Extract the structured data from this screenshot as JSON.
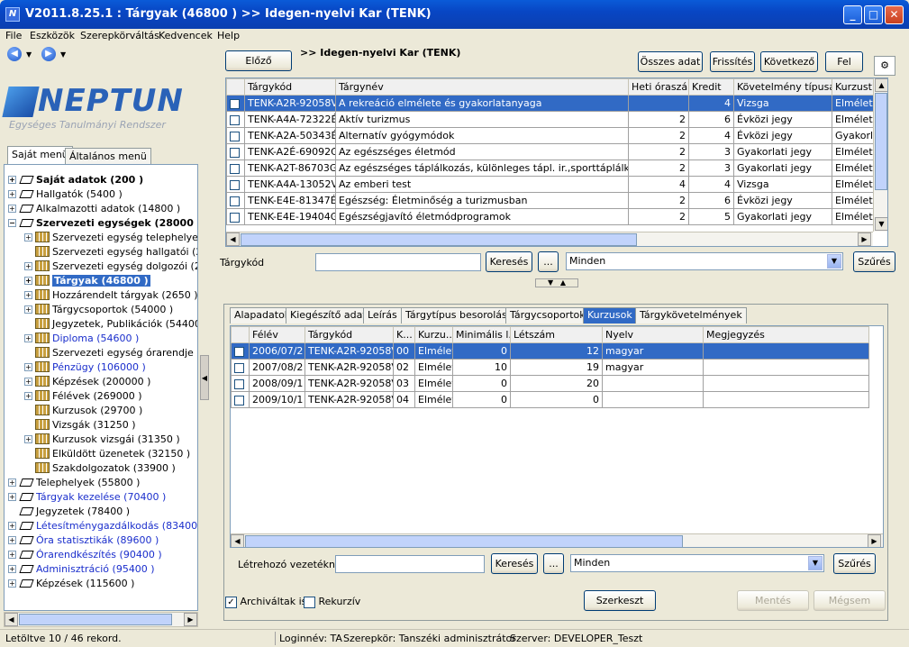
{
  "window": {
    "title": "V2011.8.25.1 : Tárgyak (46800  )  >> Idegen-nyelvi Kar (TENK)",
    "app_icon": "N"
  },
  "menu": [
    "File",
    "Eszközök",
    "Szerepkörváltás",
    "Kedvencek",
    "Help"
  ],
  "logo": {
    "name": "NEPTUN",
    "subtitle": "Egységes Tanulmányi Rendszer"
  },
  "left_tabs": [
    "Saját menü",
    "Általános menü"
  ],
  "tree": [
    {
      "label": "Saját adatok (200  )",
      "level": 0,
      "exp": "+",
      "icon": "tag-icon",
      "bold": true
    },
    {
      "label": "Hallgatók (5400  )",
      "level": 0,
      "exp": "+",
      "icon": "tag-icon"
    },
    {
      "label": "Alkalmazotti adatok (14800  )",
      "level": 0,
      "exp": "+",
      "icon": "tag-icon"
    },
    {
      "label": "Szervezeti egységek (28000  )",
      "level": 0,
      "exp": "−",
      "icon": "tag-icon",
      "bold": true
    },
    {
      "label": "Szervezeti egység telephelyei (28",
      "level": 1,
      "exp": "+",
      "icon": "grid-icon"
    },
    {
      "label": "Szervezeti egység hallgatói (2860",
      "level": 1,
      "exp": "",
      "icon": "grid-icon"
    },
    {
      "label": "Szervezeti egység dolgozói (2880",
      "level": 1,
      "exp": "+",
      "icon": "grid-icon"
    },
    {
      "label": "Tárgyak (46800  )",
      "level": 1,
      "exp": "+",
      "icon": "grid-icon",
      "selected": true,
      "bold": true
    },
    {
      "label": "Hozzárendelt tárgyak (2650  )",
      "level": 1,
      "exp": "+",
      "icon": "grid-icon"
    },
    {
      "label": "Tárgycsoportok (54000  )",
      "level": 1,
      "exp": "+",
      "icon": "grid-icon"
    },
    {
      "label": "Jegyzetek, Publikációk (54400  )",
      "level": 1,
      "exp": "",
      "icon": "grid-icon"
    },
    {
      "label": "Diploma (54600  )",
      "level": 1,
      "exp": "+",
      "icon": "grid-icon",
      "blue": true
    },
    {
      "label": "Szervezeti egység órarendje (559",
      "level": 1,
      "exp": "",
      "icon": "grid-icon"
    },
    {
      "label": "Pénzügy (106000  )",
      "level": 1,
      "exp": "+",
      "icon": "grid-icon",
      "blue": true
    },
    {
      "label": "Képzések (200000  )",
      "level": 1,
      "exp": "+",
      "icon": "grid-icon"
    },
    {
      "label": "Félévek (269000  )",
      "level": 1,
      "exp": "+",
      "icon": "grid-icon"
    },
    {
      "label": "Kurzusok (29700  )",
      "level": 1,
      "exp": "",
      "icon": "grid-icon"
    },
    {
      "label": "Vizsgák (31250  )",
      "level": 1,
      "exp": "",
      "icon": "grid-icon"
    },
    {
      "label": "Kurzusok vizsgái (31350  )",
      "level": 1,
      "exp": "+",
      "icon": "grid-icon"
    },
    {
      "label": "Elküldött üzenetek (32150  )",
      "level": 1,
      "exp": "",
      "icon": "grid-icon"
    },
    {
      "label": "Szakdolgozatok (33900  )",
      "level": 1,
      "exp": "",
      "icon": "grid-icon"
    },
    {
      "label": "Telephelyek (55800  )",
      "level": 0,
      "exp": "+",
      "icon": "tag-icon"
    },
    {
      "label": "Tárgyak kezelése (70400  )",
      "level": 0,
      "exp": "+",
      "icon": "tag-icon",
      "blue": true
    },
    {
      "label": "Jegyzetek (78400  )",
      "level": 0,
      "exp": "",
      "icon": "tag-icon"
    },
    {
      "label": "Létesítménygazdálkodás (83400  )",
      "level": 0,
      "exp": "+",
      "icon": "tag-icon",
      "blue": true
    },
    {
      "label": "Óra statisztikák (89600  )",
      "level": 0,
      "exp": "+",
      "icon": "tag-icon",
      "blue": true
    },
    {
      "label": "Órarendkészítés (90400  )",
      "level": 0,
      "exp": "+",
      "icon": "tag-icon",
      "blue": true
    },
    {
      "label": "Adminisztráció (95400  )",
      "level": 0,
      "exp": "+",
      "icon": "tag-icon",
      "blue": true
    },
    {
      "label": "Képzések (115600  )",
      "level": 0,
      "exp": "+",
      "icon": "tag-icon"
    }
  ],
  "top": {
    "prev_label": "Előző",
    "title": ">> Idegen-nyelvi Kar (TENK)",
    "all_data_label": "Összes adat",
    "refresh_label": "Frissítés",
    "next_label": "Következő",
    "up_label": "Fel",
    "columns": [
      "Tárgykód",
      "Tárgynév",
      "Heti óraszá...",
      "Kredit",
      "Követelmény típusa",
      "Kurzustíp"
    ],
    "rows": [
      [
        "TENK-A2R-92058V",
        "A rekreáció elmélete és gyakorlatanyaga",
        "",
        "4",
        "Vizsga",
        "Elmélet"
      ],
      [
        "TENK-A4A-72322É",
        "Aktív turizmus",
        "2",
        "6",
        "Évközi jegy",
        "Elmélet"
      ],
      [
        "TENK-A2A-50343É",
        "Alternatív gyógymódok",
        "2",
        "4",
        "Évközi jegy",
        "Gyakorlat"
      ],
      [
        "TENK-A2É-69092G",
        "Az egészséges életmód",
        "2",
        "3",
        "Gyakorlati jegy",
        "Elmélet"
      ],
      [
        "TENK-A2T-86703G",
        "Az egészséges táplálkozás, különleges tápl. ir.,sporttáplálk",
        "2",
        "3",
        "Gyakorlati jegy",
        "Elmélet"
      ],
      [
        "TENK-A4A-13052V",
        "Az emberi test",
        "4",
        "4",
        "Vizsga",
        "Elmélet"
      ],
      [
        "TENK-E4E-81347É",
        "Egészség: Életminőség a turizmusban",
        "2",
        "6",
        "Évközi jegy",
        "Elmélet"
      ],
      [
        "TENK-E4E-19404G",
        "Egészségjavító életmódprogramok",
        "2",
        "5",
        "Gyakorlati jegy",
        "Elmélet"
      ]
    ],
    "search_label": "Tárgykód",
    "search_value": "",
    "search_button": "Keresés",
    "ellipsis": "...",
    "filter": "Minden",
    "filter_button": "Szűrés"
  },
  "bottom": {
    "tabs": [
      "Alapadatok",
      "Kiegészítő adatok",
      "Leírás",
      "Tárgytípus besorolás",
      "Tárgycsoportok",
      "Kurzusok",
      "Tárgykövetelmények"
    ],
    "active_tab": "Kurzusok",
    "columns": [
      "Félév",
      "Tárgykód",
      "K...",
      "Kurzu...",
      "Minimális l...",
      "Létszám",
      "Nyelv",
      "Megjegyzés"
    ],
    "rows": [
      [
        "2006/07/2",
        "TENK-A2R-92058V",
        "00",
        "Elmélet",
        "0",
        "12",
        "magyar",
        ""
      ],
      [
        "2007/08/2",
        "TENK-A2R-92058V",
        "02",
        "Elmélet",
        "10",
        "19",
        "magyar",
        ""
      ],
      [
        "2008/09/1",
        "TENK-A2R-92058V",
        "03",
        "Elmélet",
        "0",
        "20",
        "",
        ""
      ],
      [
        "2009/10/1",
        "TENK-A2R-92058V",
        "04",
        "Elmélet",
        "0",
        "0",
        "",
        ""
      ]
    ],
    "creator_label": "Létrehozó vezetékn...",
    "creator_value": "",
    "search_button": "Keresés",
    "ellipsis": "...",
    "filter": "Minden",
    "filter_button": "Szűrés",
    "archived_label": "Archiváltak is",
    "archived_checked": true,
    "recursive_label": "Rekurzív",
    "recursive_checked": false,
    "edit_label": "Szerkeszt",
    "save_label": "Mentés",
    "cancel_label": "Mégsem"
  },
  "status": {
    "records": "Letöltve 10 / 46 rekord.",
    "login": "Loginnév: TA",
    "role": "Szerepkör: Tanszéki adminisztrátor",
    "server": "Szerver: DEVELOPER_Teszt"
  }
}
